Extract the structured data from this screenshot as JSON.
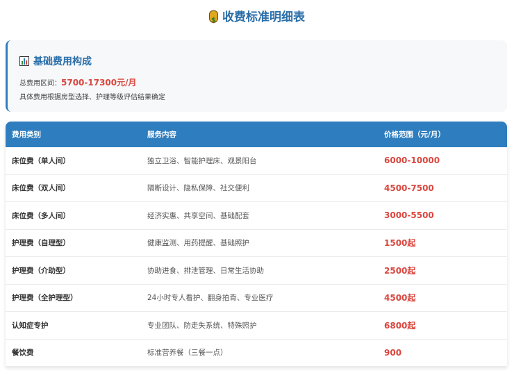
{
  "title": "收费标准明细表",
  "summary": {
    "heading": "基础费用构成",
    "total_label": "总费用区间：",
    "total_value": "5700-17300元/月",
    "note": "具体费用根据房型选择、护理等级评估结果确定"
  },
  "table": {
    "headers": [
      "费用类别",
      "服务内容",
      "价格范围（元/月）"
    ],
    "rows": [
      {
        "category": "床位费（单人间）",
        "service": "独立卫浴、智能护理床、观景阳台",
        "price": "6000-10000"
      },
      {
        "category": "床位费（双人间）",
        "service": "隔断设计、隐私保障、社交便利",
        "price": "4500-7500"
      },
      {
        "category": "床位费（多人间）",
        "service": "经济实惠、共享空间、基础配套",
        "price": "3000-5500"
      },
      {
        "category": "护理费（自理型）",
        "service": "健康监测、用药提醒、基础照护",
        "price": "1500起"
      },
      {
        "category": "护理费（介助型）",
        "service": "协助进食、排泄管理、日常生活协助",
        "price": "2500起"
      },
      {
        "category": "护理费（全护理型）",
        "service": "24小时专人看护、翻身拍背、专业医疗",
        "price": "4500起"
      },
      {
        "category": "认知症专护",
        "service": "专业团队、防走失系统、特殊照护",
        "price": "6800起"
      },
      {
        "category": "餐饮费",
        "service": "标准营养餐（三餐一点）",
        "price": "900"
      }
    ]
  }
}
